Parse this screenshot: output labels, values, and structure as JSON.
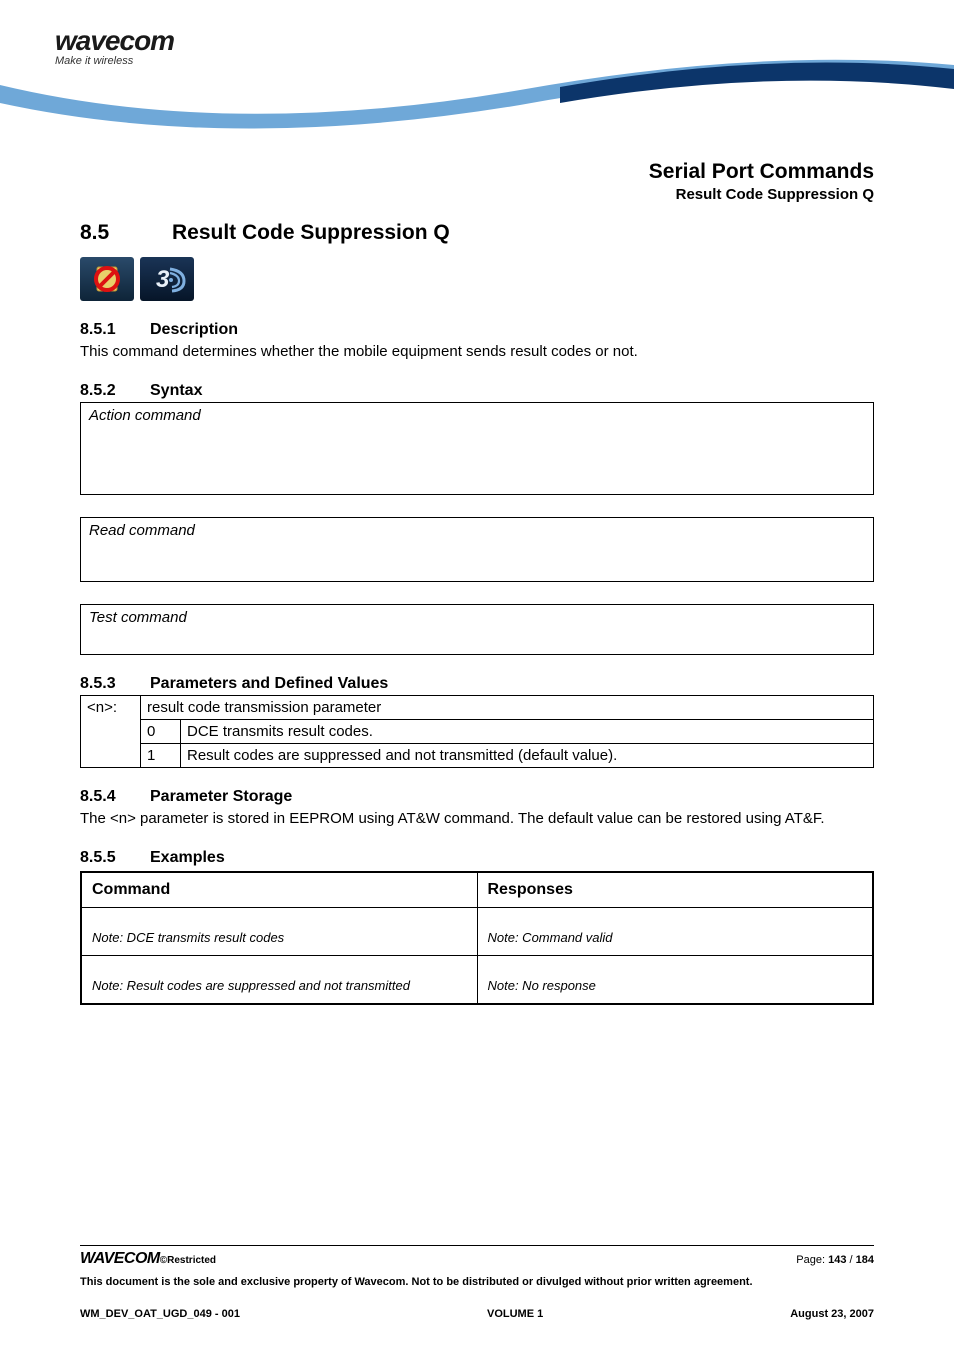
{
  "header": {
    "logo_main": "wavecom",
    "logo_tag": "Make it wireless",
    "chapter_title": "Serial Port Commands",
    "section_subtitle": "Result Code Suppression Q"
  },
  "section": {
    "number": "8.5",
    "title": "Result Code Suppression Q"
  },
  "icons": {
    "nosim": "no-sim-icon",
    "threeg": "3g-icon"
  },
  "subs": {
    "desc": {
      "num": "8.5.1",
      "title": "Description",
      "text": "This command determines whether the mobile equipment sends result codes or not."
    },
    "syntax": {
      "num": "8.5.2",
      "title": "Syntax",
      "action": "Action command",
      "read": "Read command",
      "test": "Test command"
    },
    "params": {
      "num": "8.5.3",
      "title": "Parameters and Defined Values",
      "key": "<n>:",
      "key_desc": "result code transmission parameter",
      "rows": [
        {
          "val": "0",
          "desc": "DCE transmits result codes."
        },
        {
          "val": "1",
          "desc": "Result codes are suppressed and not transmitted (default value)."
        }
      ]
    },
    "storage": {
      "num": "8.5.4",
      "title": "Parameter Storage",
      "text": "The <n> parameter is stored in EEPROM using AT&W command. The default value can be restored using AT&F."
    },
    "examples": {
      "num": "8.5.5",
      "title": "Examples",
      "head_cmd": "Command",
      "head_resp": "Responses",
      "rows": [
        {
          "cmd_note": "Note: DCE transmits result codes",
          "resp_note": "Note: Command valid"
        },
        {
          "cmd_note": "Note: Result codes are suppressed and not transmitted",
          "resp_note": "Note: No response"
        }
      ]
    }
  },
  "footer": {
    "logo": "WAVECOM",
    "restricted": "©Restricted",
    "page_label": "Page: ",
    "page_cur": "143",
    "page_sep": " / ",
    "page_total": "184",
    "disclaimer": "This document is the sole and exclusive property of Wavecom. Not to be distributed or divulged without prior written agreement.",
    "doc_id": "WM_DEV_OAT_UGD_049 - 001",
    "volume": "VOLUME 1",
    "date": "August 23, 2007"
  }
}
